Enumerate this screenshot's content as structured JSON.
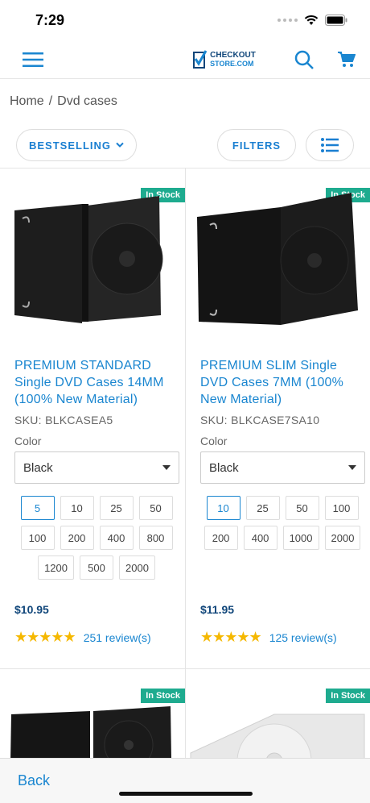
{
  "status": {
    "time": "7:29"
  },
  "header": {
    "logo_line1": "CHECKOUT",
    "logo_line2": "STORE.COM"
  },
  "breadcrumb": {
    "home": "Home",
    "separator": "/",
    "current": "Dvd cases"
  },
  "toolbar": {
    "sort_label": "BESTSELLING",
    "filters_label": "FILTERS"
  },
  "colors": {
    "accent": "#1a86d0",
    "stock_badge": "#1eab8f",
    "price": "#10467a",
    "star": "#f5b800"
  },
  "products": [
    {
      "badge": "In Stock",
      "title": "PREMIUM STANDARD Single DVD Cases 14MM (100% New Material)",
      "sku": "SKU: BLKCASEA5",
      "color_label": "Color",
      "color_value": "Black",
      "quantities": [
        "5",
        "10",
        "25",
        "50",
        "100",
        "200",
        "400",
        "800",
        "1200",
        "500",
        "2000"
      ],
      "selected_quantity": "5",
      "price": "$10.95",
      "rating": 5,
      "stars": "★★★★★",
      "reviews": "251 review(s)"
    },
    {
      "badge": "In Stock",
      "title": "PREMIUM SLIM Single DVD Cases 7MM (100% New Material)",
      "sku": "SKU: BLKCASE7SA10",
      "color_label": "Color",
      "color_value": "Black",
      "quantities": [
        "10",
        "25",
        "50",
        "100",
        "200",
        "400",
        "1000",
        "2000"
      ],
      "selected_quantity": "10",
      "price": "$11.95",
      "rating": 5,
      "stars": "★★★★★",
      "reviews": "125 review(s)"
    },
    {
      "badge": "In Stock"
    },
    {
      "badge": "In Stock"
    }
  ],
  "footer": {
    "back_label": "Back"
  }
}
